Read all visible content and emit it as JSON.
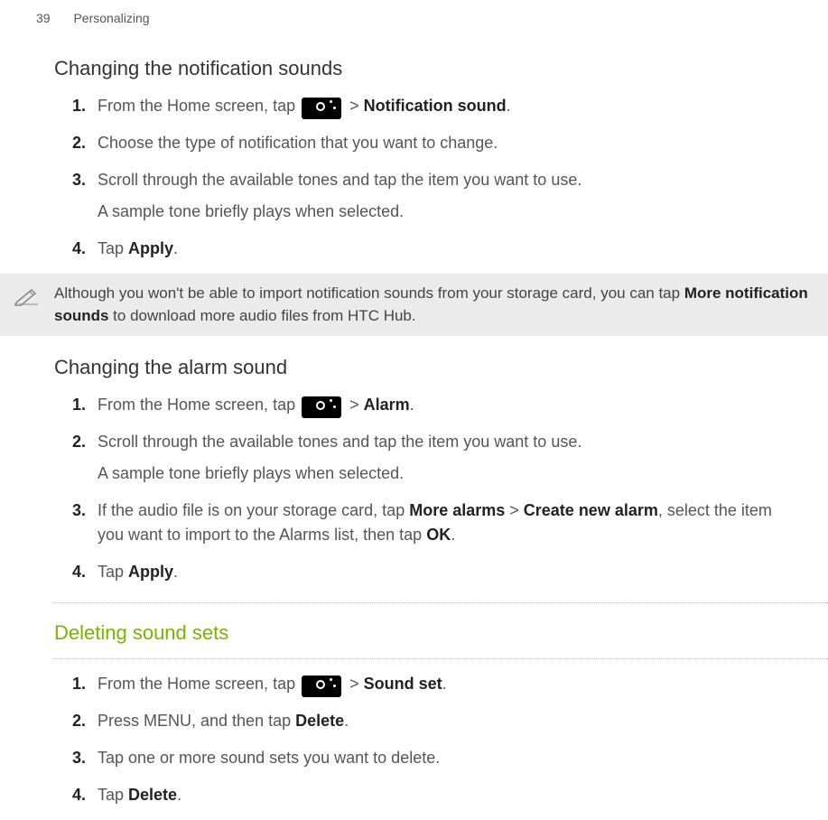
{
  "page": {
    "number": "39",
    "chapter": "Personalizing"
  },
  "section1": {
    "heading": "Changing the notification sounds",
    "steps": [
      {
        "num": "1.",
        "pre": "From the Home screen, tap ",
        "post_sep": " > ",
        "post_bold": "Notification sound",
        "post_tail": "."
      },
      {
        "num": "2.",
        "text": "Choose the type of notification that you want to change."
      },
      {
        "num": "3.",
        "text": "Scroll through the available tones and tap the item you want to use.",
        "follow": "A sample tone briefly plays when selected."
      },
      {
        "num": "4.",
        "pre": "Tap ",
        "bold": "Apply",
        "tail": "."
      }
    ]
  },
  "note": {
    "pre": "Although you won't be able to import notification sounds from your storage card, you can tap ",
    "bold": "More notification sounds",
    "tail": " to download more audio files from HTC Hub."
  },
  "section2": {
    "heading": "Changing the alarm sound",
    "steps": [
      {
        "num": "1.",
        "pre": "From the Home screen, tap ",
        "post_sep": " > ",
        "post_bold": "Alarm",
        "post_tail": "."
      },
      {
        "num": "2.",
        "text": "Scroll through the available tones and tap the item you want to use.",
        "follow": "A sample tone briefly plays when selected."
      },
      {
        "num": "3.",
        "pre": "If the audio file is on your storage card, tap ",
        "b1": "More alarms",
        "mid1": " > ",
        "b2": "Create new alarm",
        "mid2": ", select the item you want to import to the Alarms list, then tap ",
        "b3": "OK",
        "tail": "."
      },
      {
        "num": "4.",
        "pre": "Tap ",
        "bold": "Apply",
        "tail": "."
      }
    ]
  },
  "section3": {
    "heading": "Deleting sound sets",
    "steps": [
      {
        "num": "1.",
        "pre": "From the Home screen, tap ",
        "post_sep": " > ",
        "post_bold": "Sound set",
        "post_tail": "."
      },
      {
        "num": "2.",
        "pre": "Press MENU, and then tap ",
        "bold": "Delete",
        "tail": "."
      },
      {
        "num": "3.",
        "text": "Tap one or more sound sets you want to delete."
      },
      {
        "num": "4.",
        "pre": "Tap ",
        "bold": "Delete",
        "tail": "."
      }
    ]
  }
}
